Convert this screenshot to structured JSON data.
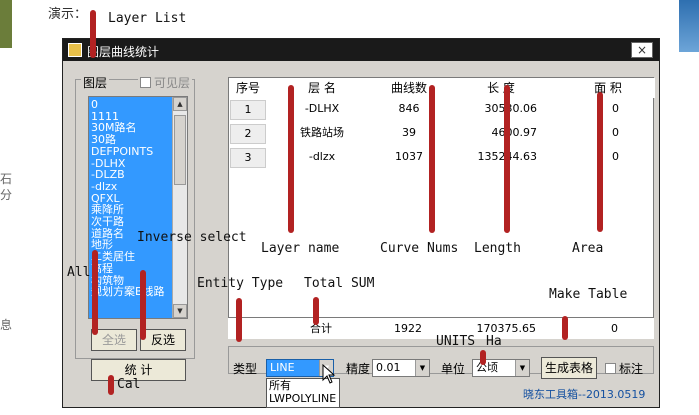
{
  "page": {
    "heading": "演示：",
    "left_strip_texts": [
      "石",
      "分",
      "息"
    ]
  },
  "window": {
    "title": "图层曲线统计",
    "close_label": "×"
  },
  "layer_panel": {
    "label": "图层",
    "visible_label": "可见层",
    "layers": [
      "0",
      "1111",
      "30M路名",
      "30路",
      "DEFPOINTS",
      "-DLHX",
      "-DLZB",
      "-dlzx",
      "QFXL",
      "乘降所",
      "次干路",
      "道路名",
      "地形",
      "二类居住",
      "高程",
      "构筑物",
      "规划方案B线路"
    ],
    "select_all": "全选",
    "inverse_select": "反选",
    "calc_button": "统 计"
  },
  "table": {
    "headers": [
      "序号",
      "层 名",
      "曲线数",
      "长 度",
      "面 积"
    ],
    "rows": [
      {
        "idx": "1",
        "name": "-DLHX",
        "count": "846",
        "length": "30530.06",
        "area": "0"
      },
      {
        "idx": "2",
        "name": "铁路站场",
        "count": "39",
        "length": "4600.97",
        "area": "0"
      },
      {
        "idx": "3",
        "name": "-dlzx",
        "count": "1037",
        "length": "135244.63",
        "area": "0"
      }
    ],
    "sum_label": "合计",
    "sum_count": "1922",
    "sum_length": "170375.65",
    "sum_area": "0"
  },
  "controls": {
    "type_label": "类型",
    "type_value": "LINE",
    "type_options": [
      "所有",
      "LWPOLYLINE"
    ],
    "precision_label": "精度",
    "precision_value": "0.01",
    "unit_label": "单位",
    "unit_value": "公顷",
    "make_table_button": "生成表格",
    "mark_label": "标注"
  },
  "footer": "晓东工具箱--2013.0519",
  "annotations": {
    "layer_list": "Layer List",
    "inverse_select": "Inverse select",
    "all": "All",
    "layer_name": "Layer name",
    "curve_nums": "Curve Nums",
    "length": "Length",
    "area": "Area",
    "entity_type": "Entity Type",
    "total_sum": "Total SUM",
    "make_table": "Make Table",
    "units": "UNITS",
    "ha": "Ha",
    "cal": "Cal"
  },
  "colors": {
    "marker": "#b22222",
    "list_selection": "#3399ff",
    "footer_text": "#1450a0"
  }
}
